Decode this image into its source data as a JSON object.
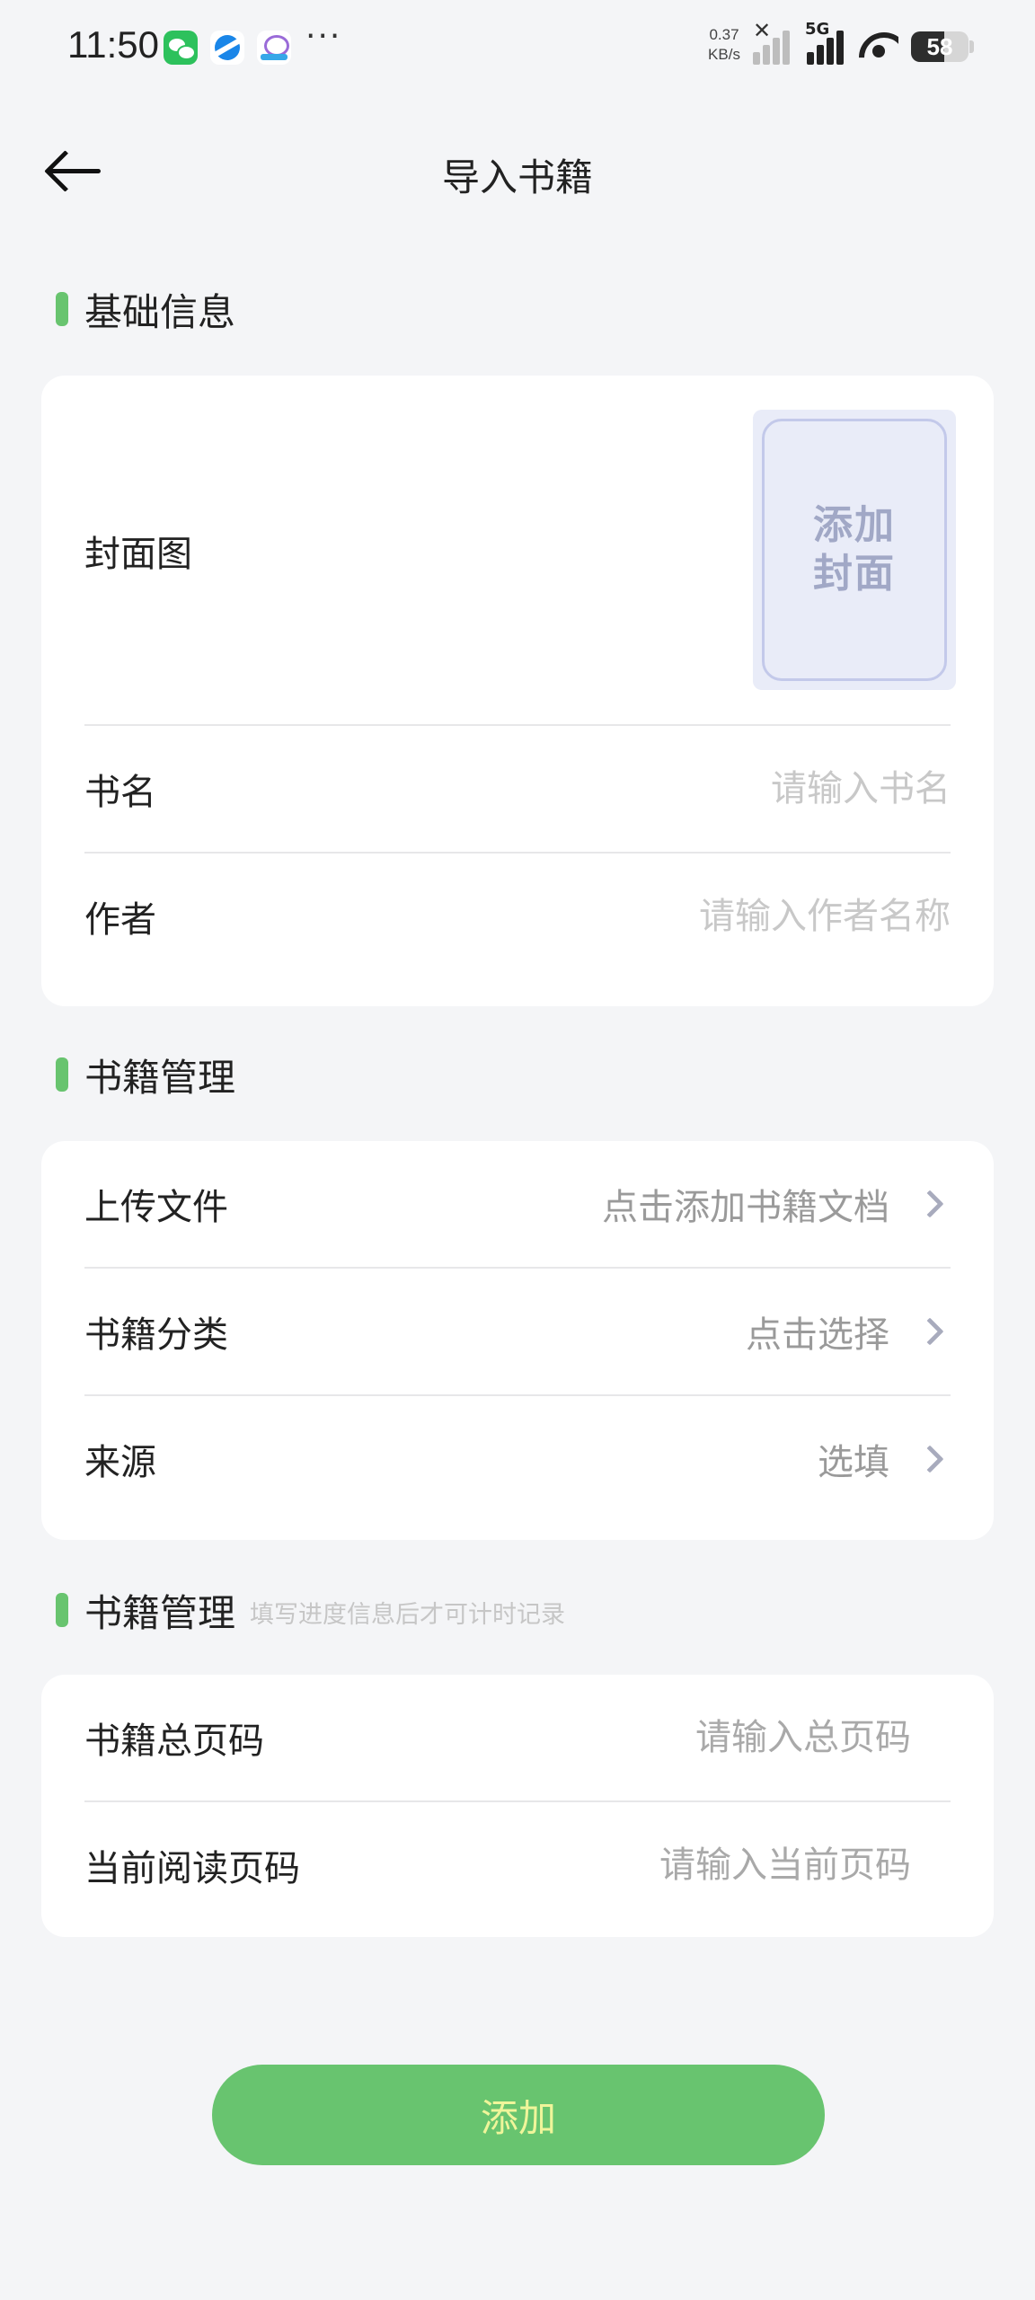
{
  "status_bar": {
    "time": "11:50",
    "net_speed_value": "0.37",
    "net_speed_unit": "KB/s",
    "network_type": "5G",
    "battery_level": "58",
    "battery_fraction": 0.58,
    "icons": [
      "wechat-icon",
      "browser-icon",
      "cloud-icon",
      "more-icon",
      "signal-nodata-icon",
      "signal-5g-icon",
      "wifi-icon",
      "battery-icon"
    ]
  },
  "nav": {
    "title": "导入书籍",
    "back_icon": "arrow-left-icon"
  },
  "basic_info": {
    "title": "基础信息",
    "cover_label": "封面图",
    "cover_placeholder_line1": "添加",
    "cover_placeholder_line2": "封面",
    "book_name_label": "书名",
    "book_name_placeholder": "请输入书名",
    "author_label": "作者",
    "author_placeholder": "请输入作者名称"
  },
  "book_manage": {
    "title": "书籍管理",
    "upload_label": "上传文件",
    "upload_value": "点击添加书籍文档",
    "category_label": "书籍分类",
    "category_value": "点击选择",
    "source_label": "来源",
    "source_value": "选填"
  },
  "progress": {
    "title": "书籍管理",
    "hint": "填写进度信息后才可计时记录",
    "total_pages_label": "书籍总页码",
    "total_pages_placeholder": "请输入总页码",
    "current_page_label": "当前阅读页码",
    "current_page_placeholder": "请输入当前页码"
  },
  "submit": {
    "label": "添加"
  },
  "colors": {
    "accent_green": "#68c46f",
    "button_text": "#eff59a",
    "background": "#f4f5f7",
    "cover_bg": "#e9ecf8"
  }
}
